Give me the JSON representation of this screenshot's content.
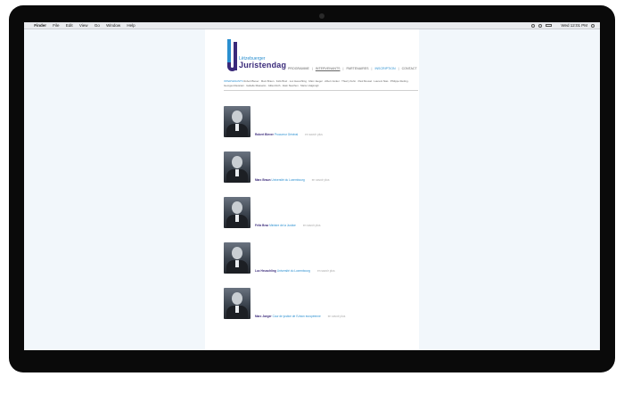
{
  "menubar": {
    "app": "Finder",
    "items": [
      "File",
      "Edit",
      "View",
      "Go",
      "Window",
      "Help"
    ],
    "clock": "Wed 12:01 PM"
  },
  "site": {
    "logo_top": "Lëtzebuerger",
    "logo_bottom": "Juristendag",
    "nav": [
      "PROGRAMME",
      "INTERVENANTS",
      "PARTENAIRES",
      "INSCRIPTION",
      "CONTACT"
    ],
    "subnav_first": "INTERVENANTS",
    "subnav_rest": "Robert Biever · Marc Braun · Félix Braz · Luc Heuschling · Marc Jaeger · Albert Junker · Thierry Kuhn · Paul Mousel · Laurent Stas · Philippe Reding · Georges Ravarani · Isabelle Riassetto · Gilles Roth · Alain Steichen · Marco Valgimigli",
    "people": [
      {
        "name": "Robert Biever",
        "org": "Procureur Général",
        "more": "en savoir plus"
      },
      {
        "name": "Marc Braun",
        "org": "Université du Luxembourg",
        "more": "en savoir plus"
      },
      {
        "name": "Félix Braz",
        "org": "Ministre de la Justice",
        "more": "en savoir plus"
      },
      {
        "name": "Luc Heuschling",
        "org": "Université du Luxembourg",
        "more": "en savoir plus"
      },
      {
        "name": "Marc Jaeger",
        "org": "Cour de justice de l'Union européenne",
        "more": "en savoir plus"
      }
    ]
  }
}
